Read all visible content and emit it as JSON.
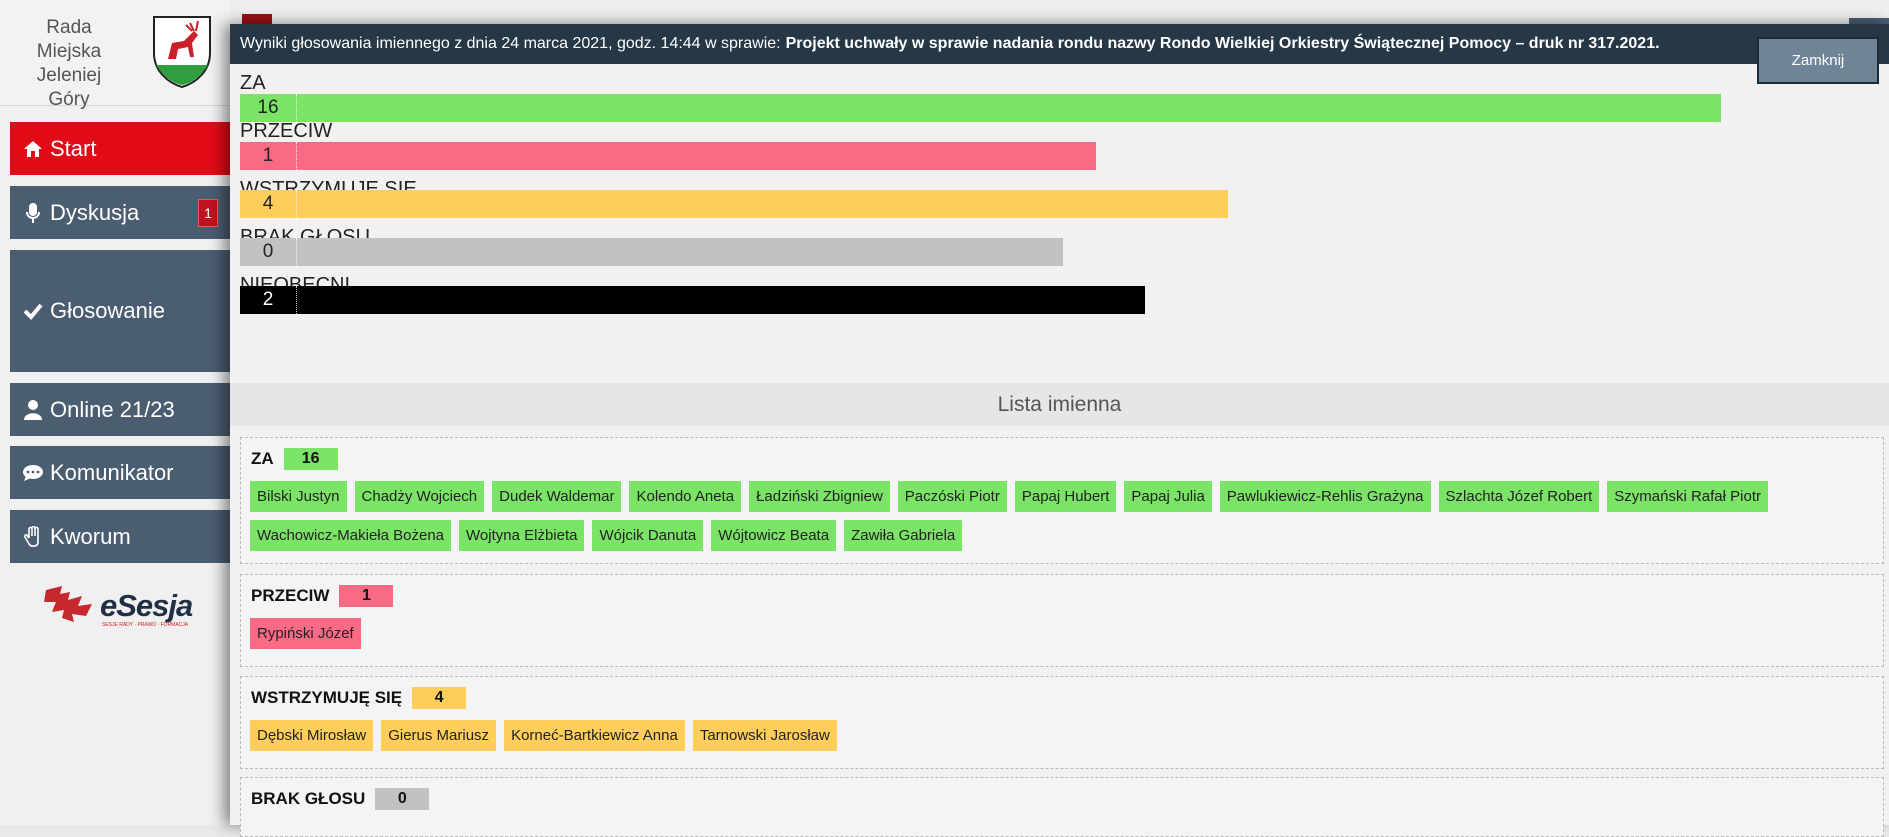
{
  "sidebar": {
    "brand_line1": "Rada Miejska",
    "brand_line2": "Jeleniej Góry",
    "items": [
      {
        "label": "Start",
        "icon": "home-icon",
        "active": true
      },
      {
        "label": "Dyskusja",
        "icon": "microphone-icon",
        "badge": "1"
      },
      {
        "label": "Głosowanie",
        "icon": "check-icon"
      },
      {
        "label": "Online 21/23",
        "icon": "user-icon"
      },
      {
        "label": "Komunikator",
        "icon": "chat-icon"
      },
      {
        "label": "Kworum",
        "icon": "hand-icon"
      }
    ],
    "logo_text": "eSesja",
    "logo_sub": "SESJE RADY · PRAWO · FORMACJA"
  },
  "modal": {
    "header_prefix": "Wyniki głosowania imiennego z dnia 24 marca 2021, godz. 14:44 w sprawie:",
    "header_subject": "Projekt uchwały w sprawie nadania rondu nazwy Rondo Wielkiej Orkiestry Świątecznej Pomocy – druk nr 317.2021.",
    "close_label": "Zamknij"
  },
  "summary": [
    {
      "label": "ZA",
      "count": "16",
      "color": "#7be467",
      "bar_fraction": 1.0
    },
    {
      "label": "PRZECIW",
      "count": "1",
      "color": "#f96b85",
      "bar_fraction": 0.578
    },
    {
      "label": "WSTRZYMUJĘ SIĘ",
      "count": "4",
      "color": "#fecd5a",
      "bar_fraction": 0.667
    },
    {
      "label": "BRAK GŁOSU",
      "count": "0",
      "color": "#c2c2c2",
      "bar_fraction": 0.556
    },
    {
      "label": "NIEOBECNI",
      "count": "2",
      "color": "#000000",
      "bar_fraction": 0.611
    }
  ],
  "list_title": "Lista imienna",
  "groups": [
    {
      "label": "ZA",
      "count": "16",
      "color": "#7be467",
      "names": [
        "Bilski Justyn",
        "Chadży Wojciech",
        "Dudek Waldemar",
        "Kolendo Aneta",
        "Ładziński Zbigniew",
        "Paczóski Piotr",
        "Papaj Hubert",
        "Papaj Julia",
        "Pawlukiewicz-Rehlis Grażyna",
        "Szlachta Józef Robert",
        "Szymański Rafał Piotr",
        "Wachowicz-Makieła Bożena",
        "Wojtyna Elżbieta",
        "Wójcik Danuta",
        "Wójtowicz Beata",
        "Zawiła Gabriela"
      ]
    },
    {
      "label": "PRZECIW",
      "count": "1",
      "color": "#f96b85",
      "names": [
        "Rypiński Józef"
      ]
    },
    {
      "label": "WSTRZYMUJĘ SIĘ",
      "count": "4",
      "color": "#fecd5a",
      "names": [
        "Dębski Mirosław",
        "Gierus Mariusz",
        "Korneć-Bartkiewicz Anna",
        "Tarnowski Jarosław"
      ]
    },
    {
      "label": "BRAK GŁOSU",
      "count": "0",
      "color": "#c2c2c2",
      "names": []
    }
  ]
}
